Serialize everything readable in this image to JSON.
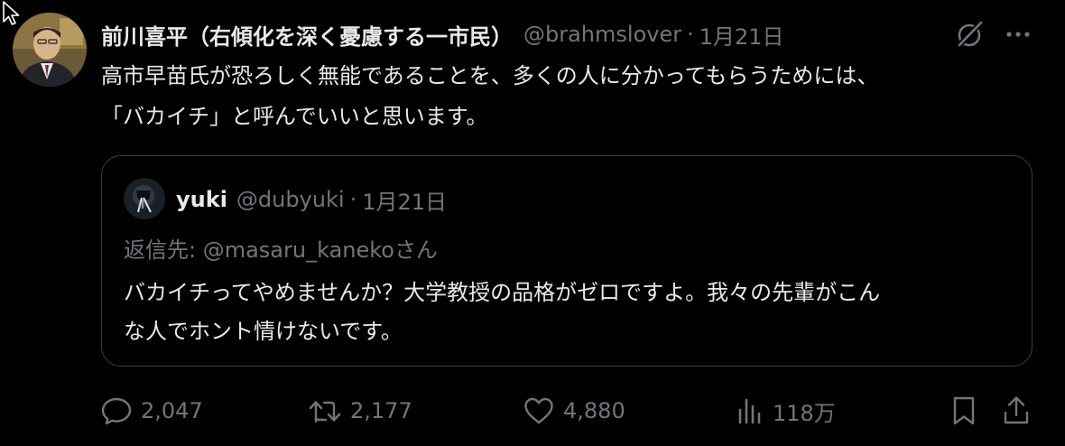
{
  "tweet": {
    "author": {
      "name": "前川喜平（右傾化を深く憂慮する一市民）",
      "handle": "@brahmslover",
      "avatar_icon": "author-avatar-photo"
    },
    "separator": "·",
    "date": "1月21日",
    "text_lines": [
      "高市早苗氏が恐ろしく無能であることを、多くの人に分かってもらうためには、",
      "「バカイチ」と呼んでいいと思います。"
    ]
  },
  "quote": {
    "author": {
      "name": "yuki",
      "handle": "@dubyuki",
      "avatar_icon": "quote-author-avatar"
    },
    "separator": "·",
    "date": "1月21日",
    "reply_to": "返信先: @masaru_kanekoさん",
    "text_lines": [
      "バカイチってやめませんか？大学教授の品格がゼロですよ。我々の先輩がこん",
      "な人でホント情けないです。"
    ]
  },
  "actions": {
    "replies": "2,047",
    "reposts": "2,177",
    "likes": "4,880",
    "views": "118万"
  },
  "colors": {
    "background": "#000000",
    "text_primary": "#e7e9ea",
    "text_secondary": "#71767b",
    "border": "#3a3d41"
  }
}
